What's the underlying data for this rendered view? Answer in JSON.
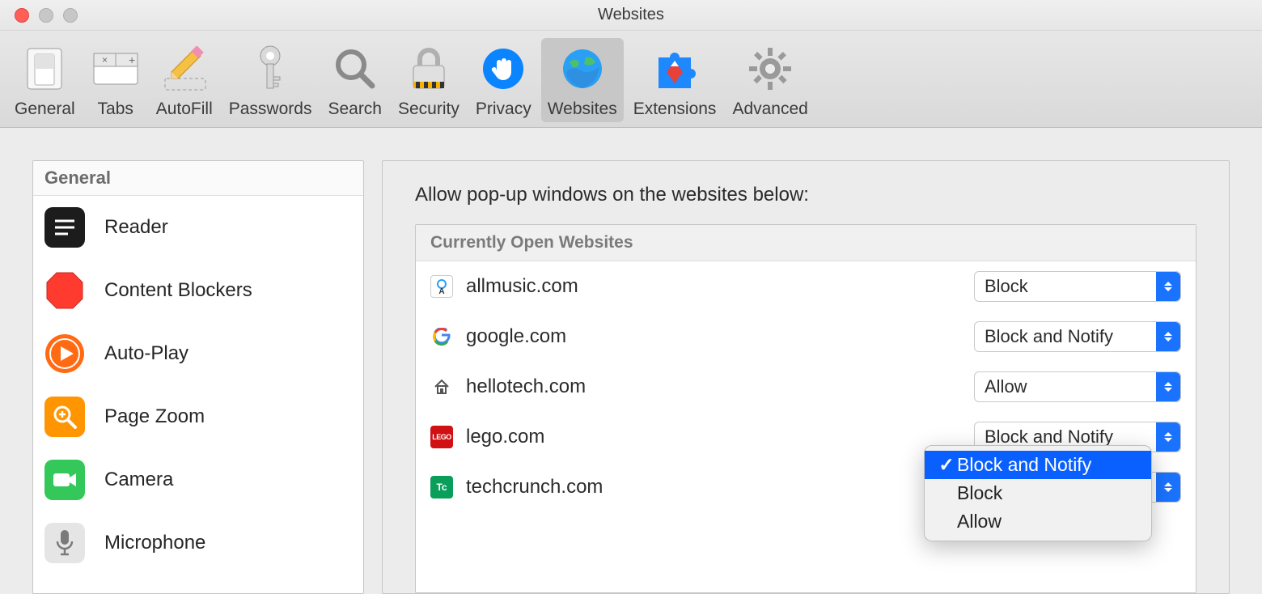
{
  "window": {
    "title": "Websites"
  },
  "toolbar": {
    "items": [
      {
        "id": "general",
        "label": "General"
      },
      {
        "id": "tabs",
        "label": "Tabs"
      },
      {
        "id": "autofill",
        "label": "AutoFill"
      },
      {
        "id": "passwords",
        "label": "Passwords"
      },
      {
        "id": "search",
        "label": "Search"
      },
      {
        "id": "security",
        "label": "Security"
      },
      {
        "id": "privacy",
        "label": "Privacy"
      },
      {
        "id": "websites",
        "label": "Websites",
        "active": true
      },
      {
        "id": "extensions",
        "label": "Extensions"
      },
      {
        "id": "advanced",
        "label": "Advanced"
      }
    ]
  },
  "sidebar": {
    "header": "General",
    "items": [
      {
        "id": "reader",
        "label": "Reader"
      },
      {
        "id": "content-blockers",
        "label": "Content Blockers"
      },
      {
        "id": "auto-play",
        "label": "Auto-Play"
      },
      {
        "id": "page-zoom",
        "label": "Page Zoom"
      },
      {
        "id": "camera",
        "label": "Camera"
      },
      {
        "id": "microphone",
        "label": "Microphone"
      }
    ]
  },
  "main": {
    "heading": "Allow pop-up windows on the websites below:",
    "section_header": "Currently Open Websites",
    "sites": [
      {
        "domain": "allmusic.com",
        "value": "Block"
      },
      {
        "domain": "google.com",
        "value": "Block and Notify"
      },
      {
        "domain": "hellotech.com",
        "value": "Allow"
      },
      {
        "domain": "lego.com",
        "value": "Block and Notify"
      },
      {
        "domain": "techcrunch.com",
        "value": ""
      }
    ],
    "dropdown": {
      "options": [
        {
          "label": "Block and Notify",
          "selected": true
        },
        {
          "label": "Block"
        },
        {
          "label": "Allow"
        }
      ]
    }
  }
}
